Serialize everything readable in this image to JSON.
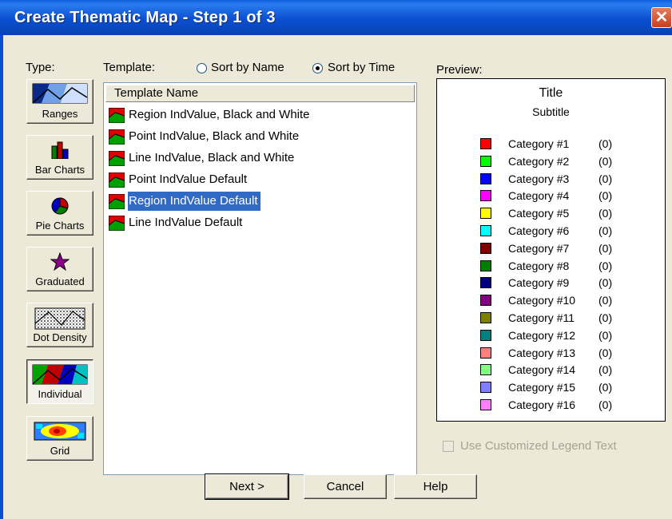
{
  "window": {
    "title": "Create Thematic Map - Step 1 of 3"
  },
  "type_label": "Type:",
  "types": [
    {
      "label": "Ranges",
      "icon": "ranges-icon"
    },
    {
      "label": "Bar Charts",
      "icon": "bar-chart-icon"
    },
    {
      "label": "Pie Charts",
      "icon": "pie-chart-icon"
    },
    {
      "label": "Graduated",
      "icon": "star-icon"
    },
    {
      "label": "Dot Density",
      "icon": "dot-density-icon"
    },
    {
      "label": "Individual",
      "icon": "individual-icon",
      "selected": true
    },
    {
      "label": "Grid",
      "icon": "grid-icon"
    }
  ],
  "template_label": "Template:",
  "sort": {
    "by_name": "Sort by Name",
    "by_time": "Sort by Time",
    "selected": "by_time"
  },
  "list": {
    "column_header": "Template Name",
    "items": [
      "Region IndValue, Black and White",
      "Point IndValue, Black and White",
      "Line IndValue, Black and White",
      "Point IndValue Default",
      "Region IndValue Default",
      "Line IndValue Default"
    ],
    "selected_index": 4
  },
  "preview": {
    "label": "Preview:",
    "title": "Title",
    "subtitle": "Subtitle",
    "categories": [
      {
        "name": "Category #1",
        "count": "(0)",
        "color": "#ff0000"
      },
      {
        "name": "Category #2",
        "count": "(0)",
        "color": "#00ff00"
      },
      {
        "name": "Category #3",
        "count": "(0)",
        "color": "#0000ff"
      },
      {
        "name": "Category #4",
        "count": "(0)",
        "color": "#ff00ff"
      },
      {
        "name": "Category #5",
        "count": "(0)",
        "color": "#ffff00"
      },
      {
        "name": "Category #6",
        "count": "(0)",
        "color": "#00ffff"
      },
      {
        "name": "Category #7",
        "count": "(0)",
        "color": "#800000"
      },
      {
        "name": "Category #8",
        "count": "(0)",
        "color": "#008000"
      },
      {
        "name": "Category #9",
        "count": "(0)",
        "color": "#000080"
      },
      {
        "name": "Category #10",
        "count": "(0)",
        "color": "#800080"
      },
      {
        "name": "Category #11",
        "count": "(0)",
        "color": "#808000"
      },
      {
        "name": "Category #12",
        "count": "(0)",
        "color": "#008080"
      },
      {
        "name": "Category #13",
        "count": "(0)",
        "color": "#ff8080"
      },
      {
        "name": "Category #14",
        "count": "(0)",
        "color": "#80ff80"
      },
      {
        "name": "Category #15",
        "count": "(0)",
        "color": "#8080ff"
      },
      {
        "name": "Category #16",
        "count": "(0)",
        "color": "#ff80ff"
      }
    ]
  },
  "custom_legend": {
    "label": "Use Customized Legend Text",
    "checked": false,
    "enabled": false
  },
  "buttons": {
    "next": "Next >",
    "cancel": "Cancel",
    "help": "Help"
  }
}
